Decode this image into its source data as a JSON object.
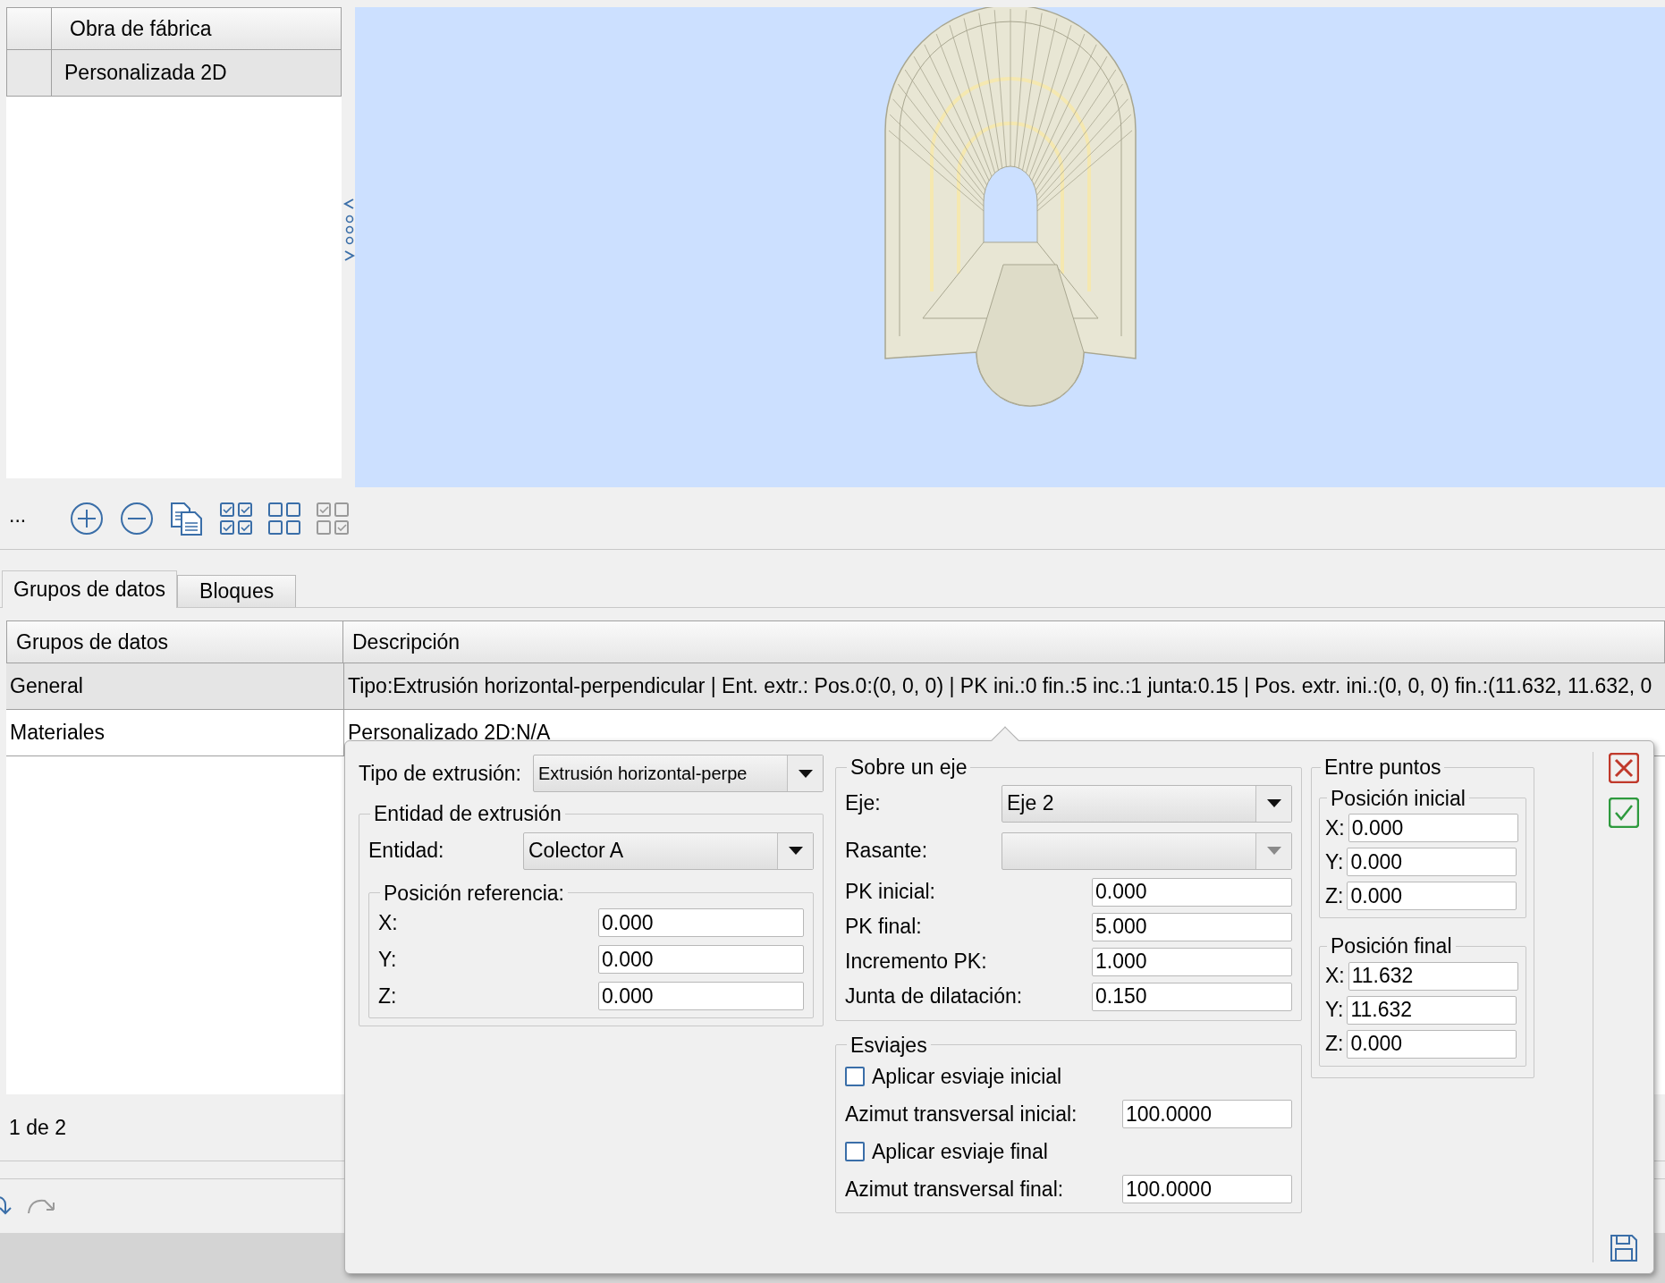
{
  "top_list": {
    "header": "Obra de fábrica",
    "rows": [
      {
        "label": "Personalizada 2D",
        "selected": true
      }
    ]
  },
  "toolbar": {
    "more": "..."
  },
  "tabs": [
    {
      "label": "Grupos de datos",
      "selected": true
    },
    {
      "label": "Bloques",
      "selected": false
    }
  ],
  "table": {
    "columns": [
      "Grupos de datos",
      "Descripción"
    ],
    "rows": [
      {
        "cells": [
          "General",
          "Tipo:Extrusión horizontal-perpendicular | Ent. extr.: Pos.0:(0, 0, 0) | PK ini.:0 fin.:5 inc.:1 junta:0.15 | Pos. extr. ini.:(0, 0, 0) fin.:(11.632, 11.632, 0"
        ],
        "selected": true
      },
      {
        "cells": [
          "Materiales",
          "Personalizado 2D:N/A"
        ],
        "selected": false
      }
    ]
  },
  "pager": "1 de 2",
  "editor": {
    "extrusion_type": {
      "label": "Tipo de extrusión:",
      "value": "Extrusión horizontal-perpe"
    },
    "entity_group": {
      "title": "Entidad de extrusión",
      "entity": {
        "label": "Entidad:",
        "value": "Colector A"
      },
      "reference": {
        "title": "Posición referencia:",
        "fields": [
          {
            "label": "X:",
            "value": "0.000"
          },
          {
            "label": "Y:",
            "value": "0.000"
          },
          {
            "label": "Z:",
            "value": "0.000"
          }
        ]
      }
    },
    "axis_group": {
      "title": "Sobre un eje",
      "dropdowns": [
        {
          "label": "Eje:",
          "value": "Eje 2",
          "disabled": false
        },
        {
          "label": "Rasante:",
          "disabled": true
        }
      ],
      "fields": [
        {
          "label": "PK inicial:",
          "value": "0.000"
        },
        {
          "label": "PK final:",
          "value": "5.000"
        },
        {
          "label": "Incremento PK:",
          "value": "1.000"
        },
        {
          "label": "Junta de dilatación:",
          "value": "0.150"
        }
      ]
    },
    "skews": {
      "title": "Esviajes",
      "rows": [
        {
          "kind": "checkbox",
          "label": "Aplicar esviaje inicial",
          "checked": false
        },
        {
          "kind": "field",
          "label": "Azimut transversal inicial:",
          "value": "100.0000"
        },
        {
          "kind": "checkbox",
          "label": "Aplicar esviaje final",
          "checked": false
        },
        {
          "kind": "field",
          "label": "Azimut transversal final:",
          "value": "100.0000"
        }
      ]
    },
    "points": {
      "title": "Entre puntos",
      "groups": [
        {
          "title": "Posición inicial",
          "fields": [
            {
              "label": "X:",
              "value": "0.000"
            },
            {
              "label": "Y:",
              "value": "0.000"
            },
            {
              "label": "Z:",
              "value": "0.000"
            }
          ]
        },
        {
          "title": "Posición final",
          "fields": [
            {
              "label": "X:",
              "value": "11.632"
            },
            {
              "label": "Y:",
              "value": "11.632"
            },
            {
              "label": "Z:",
              "value": "0.000"
            }
          ]
        }
      ]
    }
  }
}
